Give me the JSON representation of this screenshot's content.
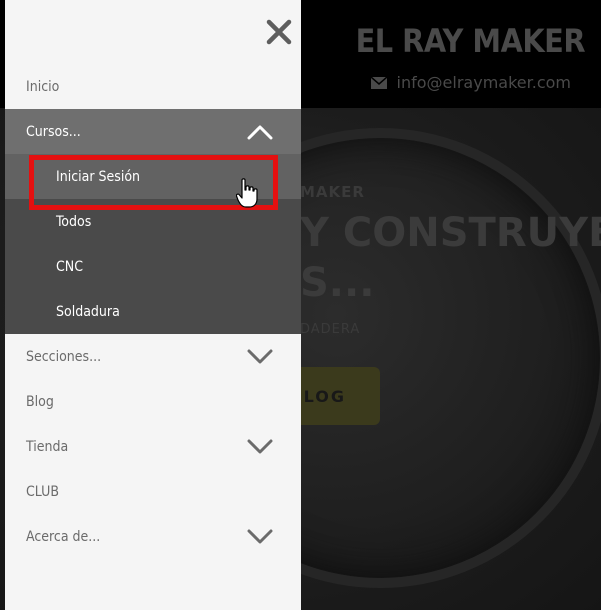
{
  "site": {
    "title": "EL RAY MAKER",
    "email": "info@elraymaker.com",
    "email_icon": "envelope-icon",
    "hero_kicker": "MAKER",
    "hero_heading": "Y CONSTRUYE",
    "hero_sub": "S...",
    "hero_small": "DADERA",
    "hero_cta": "BLOG"
  },
  "drawer": {
    "close_icon": "close-icon",
    "items": [
      {
        "label": "Inicio",
        "has_chevron": false
      },
      {
        "label": "Cursos...",
        "has_chevron": true,
        "expanded": true
      },
      {
        "label": "Secciones...",
        "has_chevron": true
      },
      {
        "label": "Blog",
        "has_chevron": false
      },
      {
        "label": "Tienda",
        "has_chevron": true
      },
      {
        "label": "CLUB",
        "has_chevron": false
      },
      {
        "label": "Acerca de...",
        "has_chevron": true
      }
    ],
    "cursos_submenu": [
      {
        "label": "Iniciar Sesión"
      },
      {
        "label": "Todos"
      },
      {
        "label": "CNC"
      },
      {
        "label": "Soldadura"
      }
    ]
  },
  "colors": {
    "drawer_bg": "#f5f5f5",
    "active_item_bg": "#6f6f6f",
    "submenu_bg": "#4a4a4a",
    "highlight_border": "#e41010"
  }
}
